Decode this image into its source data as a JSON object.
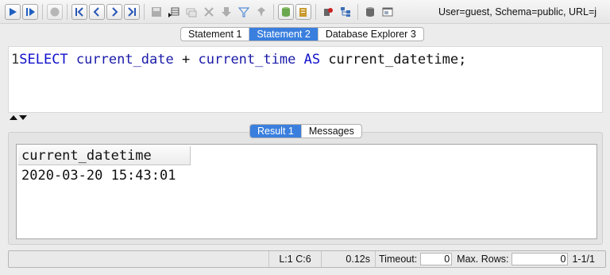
{
  "toolbar": {
    "buttons": [
      {
        "name": "run-icon",
        "color": "#1f5fbf"
      },
      {
        "name": "run-current-icon",
        "color": "#1f5fbf"
      },
      {
        "name": "stop-icon",
        "color": "#8a8a8a"
      },
      {
        "name": "first-row-icon",
        "color": "#2a57b5"
      },
      {
        "name": "prev-row-icon",
        "color": "#2a57b5"
      },
      {
        "name": "next-row-icon",
        "color": "#2a57b5"
      },
      {
        "name": "last-row-icon",
        "color": "#2a57b5"
      },
      {
        "name": "save-icon",
        "color": "#7a7a7a"
      },
      {
        "name": "insert-row-icon",
        "color": "#7a7a7a"
      },
      {
        "name": "copy-row-icon",
        "color": "#7a7a7a"
      },
      {
        "name": "delete-row-icon",
        "color": "#7a7a7a"
      },
      {
        "name": "commit-icon",
        "color": "#7a7a7a"
      },
      {
        "name": "filter-icon",
        "color": "#5a8fd6"
      },
      {
        "name": "pin-icon",
        "color": "#7a7a7a"
      },
      {
        "name": "database-icon",
        "color": "#6aa84f"
      },
      {
        "name": "export-icon",
        "color": "#c99a2e"
      },
      {
        "name": "error-log-icon",
        "color": "#cc2222"
      },
      {
        "name": "schema-tree-icon",
        "color": "#3d6fb8"
      },
      {
        "name": "table-icon",
        "color": "#6a6a6a"
      },
      {
        "name": "window-icon",
        "color": "#6a6a6a"
      }
    ],
    "connection_text": "User=guest, Schema=public, URL=j"
  },
  "statement_tabs": [
    {
      "label": "Statement 1",
      "active": false
    },
    {
      "label": "Statement 2",
      "active": true
    },
    {
      "label": "Database Explorer 3",
      "active": false
    }
  ],
  "editor": {
    "line_number": "1",
    "sql": {
      "keyword_select": "SELECT",
      "ident_1": "current_date",
      "operator": "+",
      "ident_2": "current_time",
      "keyword_as": "AS",
      "alias": "current_datetime;"
    }
  },
  "result_tabs": [
    {
      "label": "Result 1",
      "active": true
    },
    {
      "label": "Messages",
      "active": false
    }
  ],
  "result": {
    "columns": [
      "current_datetime"
    ],
    "rows": [
      [
        "2020-03-20 15:43:01"
      ]
    ]
  },
  "status": {
    "message": "",
    "position": "L:1 C:6",
    "elapsed": "0.12s",
    "timeout_label": "Timeout:",
    "timeout_value": "0",
    "max_rows_label": "Max. Rows:",
    "max_rows_value": "0",
    "row_range": "1-1/1"
  },
  "colors": {
    "active_tab": "#3a7fde",
    "keyword": "#1010cc",
    "identifier": "#1a1aa8"
  }
}
